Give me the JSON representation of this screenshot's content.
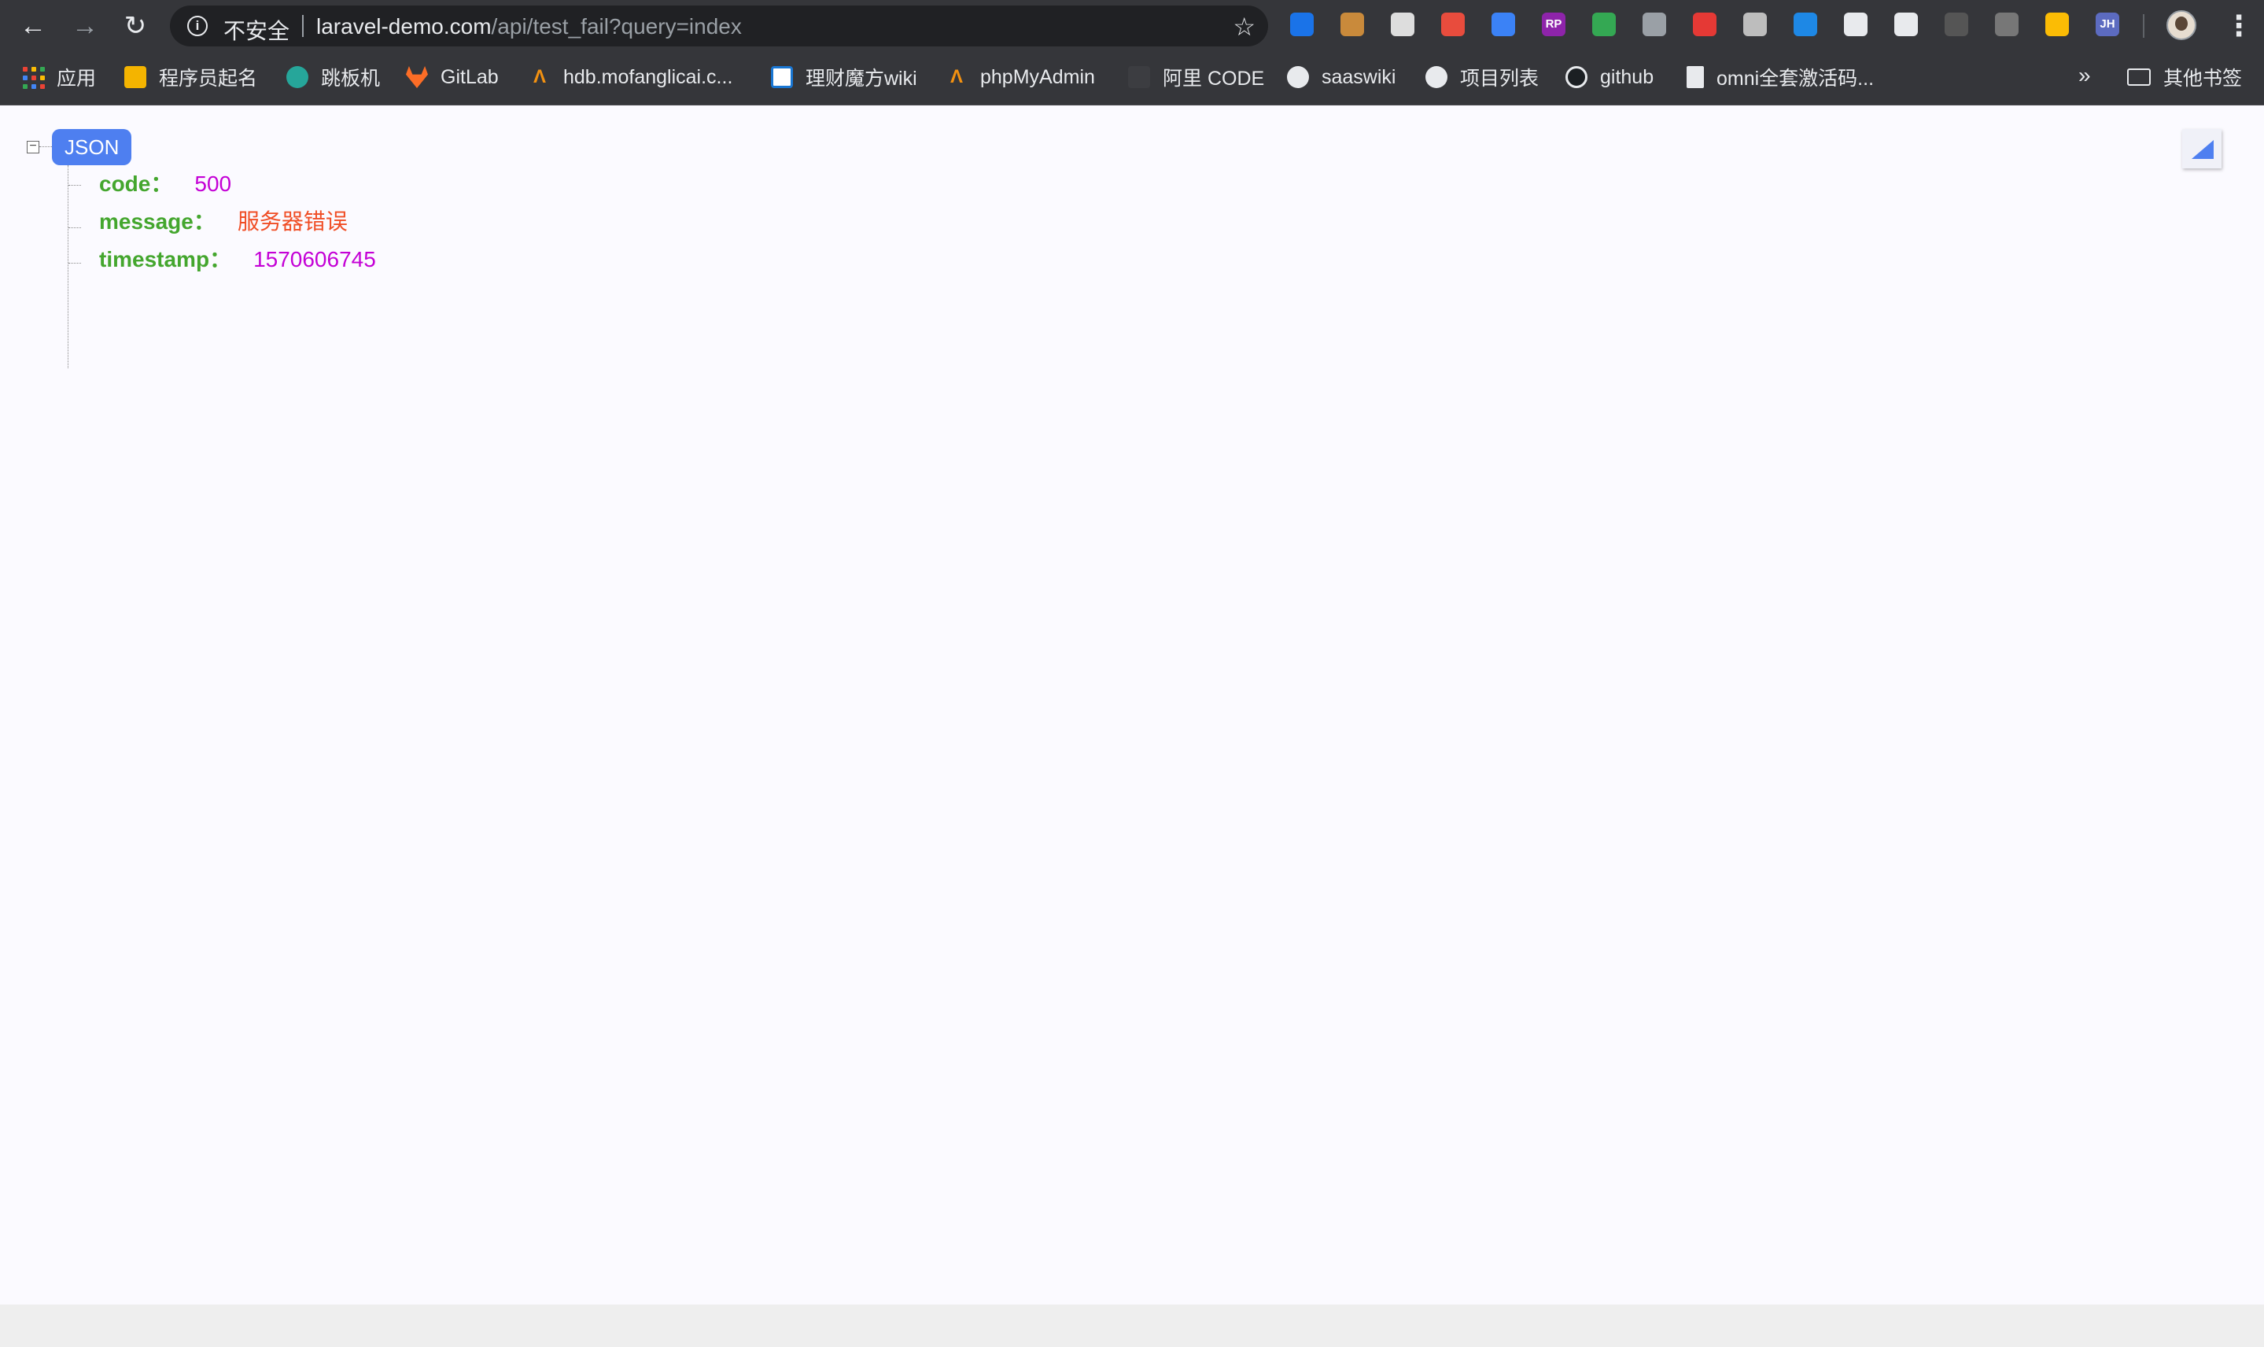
{
  "browser": {
    "security_label": "不安全",
    "url_host": "laravel-demo.com",
    "url_path": "/api/test_fail?query=index",
    "extensions": [
      {
        "name": "bullseye-ext-icon",
        "color": "#1a73e8"
      },
      {
        "name": "cookie-ext-icon",
        "color": "#c98a3b"
      },
      {
        "name": "translate-ext-icon",
        "color": "#dddddd"
      },
      {
        "name": "pinwheel-ext-icon",
        "color": "#e84c3d"
      },
      {
        "name": "edit-ext-icon",
        "color": "#3b82f6"
      },
      {
        "name": "rp-ext-icon",
        "color": "#8e24aa",
        "label": "RP"
      },
      {
        "name": "shield-ext-icon",
        "color": "#34a853"
      },
      {
        "name": "vue-ext-icon",
        "color": "#9aa0a6"
      },
      {
        "name": "translate-red-ext-icon",
        "color": "#e53935"
      },
      {
        "name": "camera-ext-icon",
        "color": "#bdbdbd"
      },
      {
        "name": "download-ext-icon",
        "color": "#1e88e5"
      },
      {
        "name": "react-ext-icon",
        "color": "#e8eaed"
      },
      {
        "name": "target-ext-icon",
        "color": "#e8eaed"
      },
      {
        "name": "qr-ext-icon",
        "color": "#555555"
      },
      {
        "name": "gear-ext-icon",
        "color": "#777777"
      },
      {
        "name": "colorful-ext-icon",
        "color": "#fbbc05"
      },
      {
        "name": "jh-ext-icon",
        "color": "#5c6bc0",
        "label": "JH"
      }
    ]
  },
  "bookmarks": [
    {
      "label": "应用",
      "icon": "apps-grid-icon"
    },
    {
      "label": "程序员起名",
      "icon": "code-name-icon",
      "color": "#f4b400"
    },
    {
      "label": "跳板机",
      "icon": "jumpserver-icon",
      "color": "#26a69a"
    },
    {
      "label": "GitLab",
      "icon": "gitlab-icon",
      "color": "#fc6d26"
    },
    {
      "label": "hdb.mofanglicai.c...",
      "icon": "phpmyadmin-sail-icon",
      "color": "#f29111"
    },
    {
      "label": "理财魔方wiki",
      "icon": "confluence-icon",
      "color": "#1976d2"
    },
    {
      "label": "phpMyAdmin",
      "icon": "phpmyadmin-sail-icon",
      "color": "#f29111"
    },
    {
      "label": "阿里 CODE",
      "icon": "aliyun-code-icon",
      "color": "#ff6a00"
    },
    {
      "label": "saaswiki",
      "icon": "globe-icon",
      "color": "#e8eaed"
    },
    {
      "label": "项目列表",
      "icon": "globe-icon",
      "color": "#e8eaed"
    },
    {
      "label": "github",
      "icon": "github-icon",
      "color": "#e8eaed"
    },
    {
      "label": "omni全套激活码...",
      "icon": "document-icon",
      "color": "#e8eaed"
    }
  ],
  "bookmarks_more": "»",
  "other_bookmarks": "其他书签",
  "json_view": {
    "root_label": "JSON",
    "colon": "：",
    "entries": [
      {
        "key": "code",
        "value": "500",
        "type": "number"
      },
      {
        "key": "message",
        "value": "服务器错误",
        "type": "string"
      },
      {
        "key": "timestamp",
        "value": "1570606745",
        "type": "number"
      }
    ]
  }
}
